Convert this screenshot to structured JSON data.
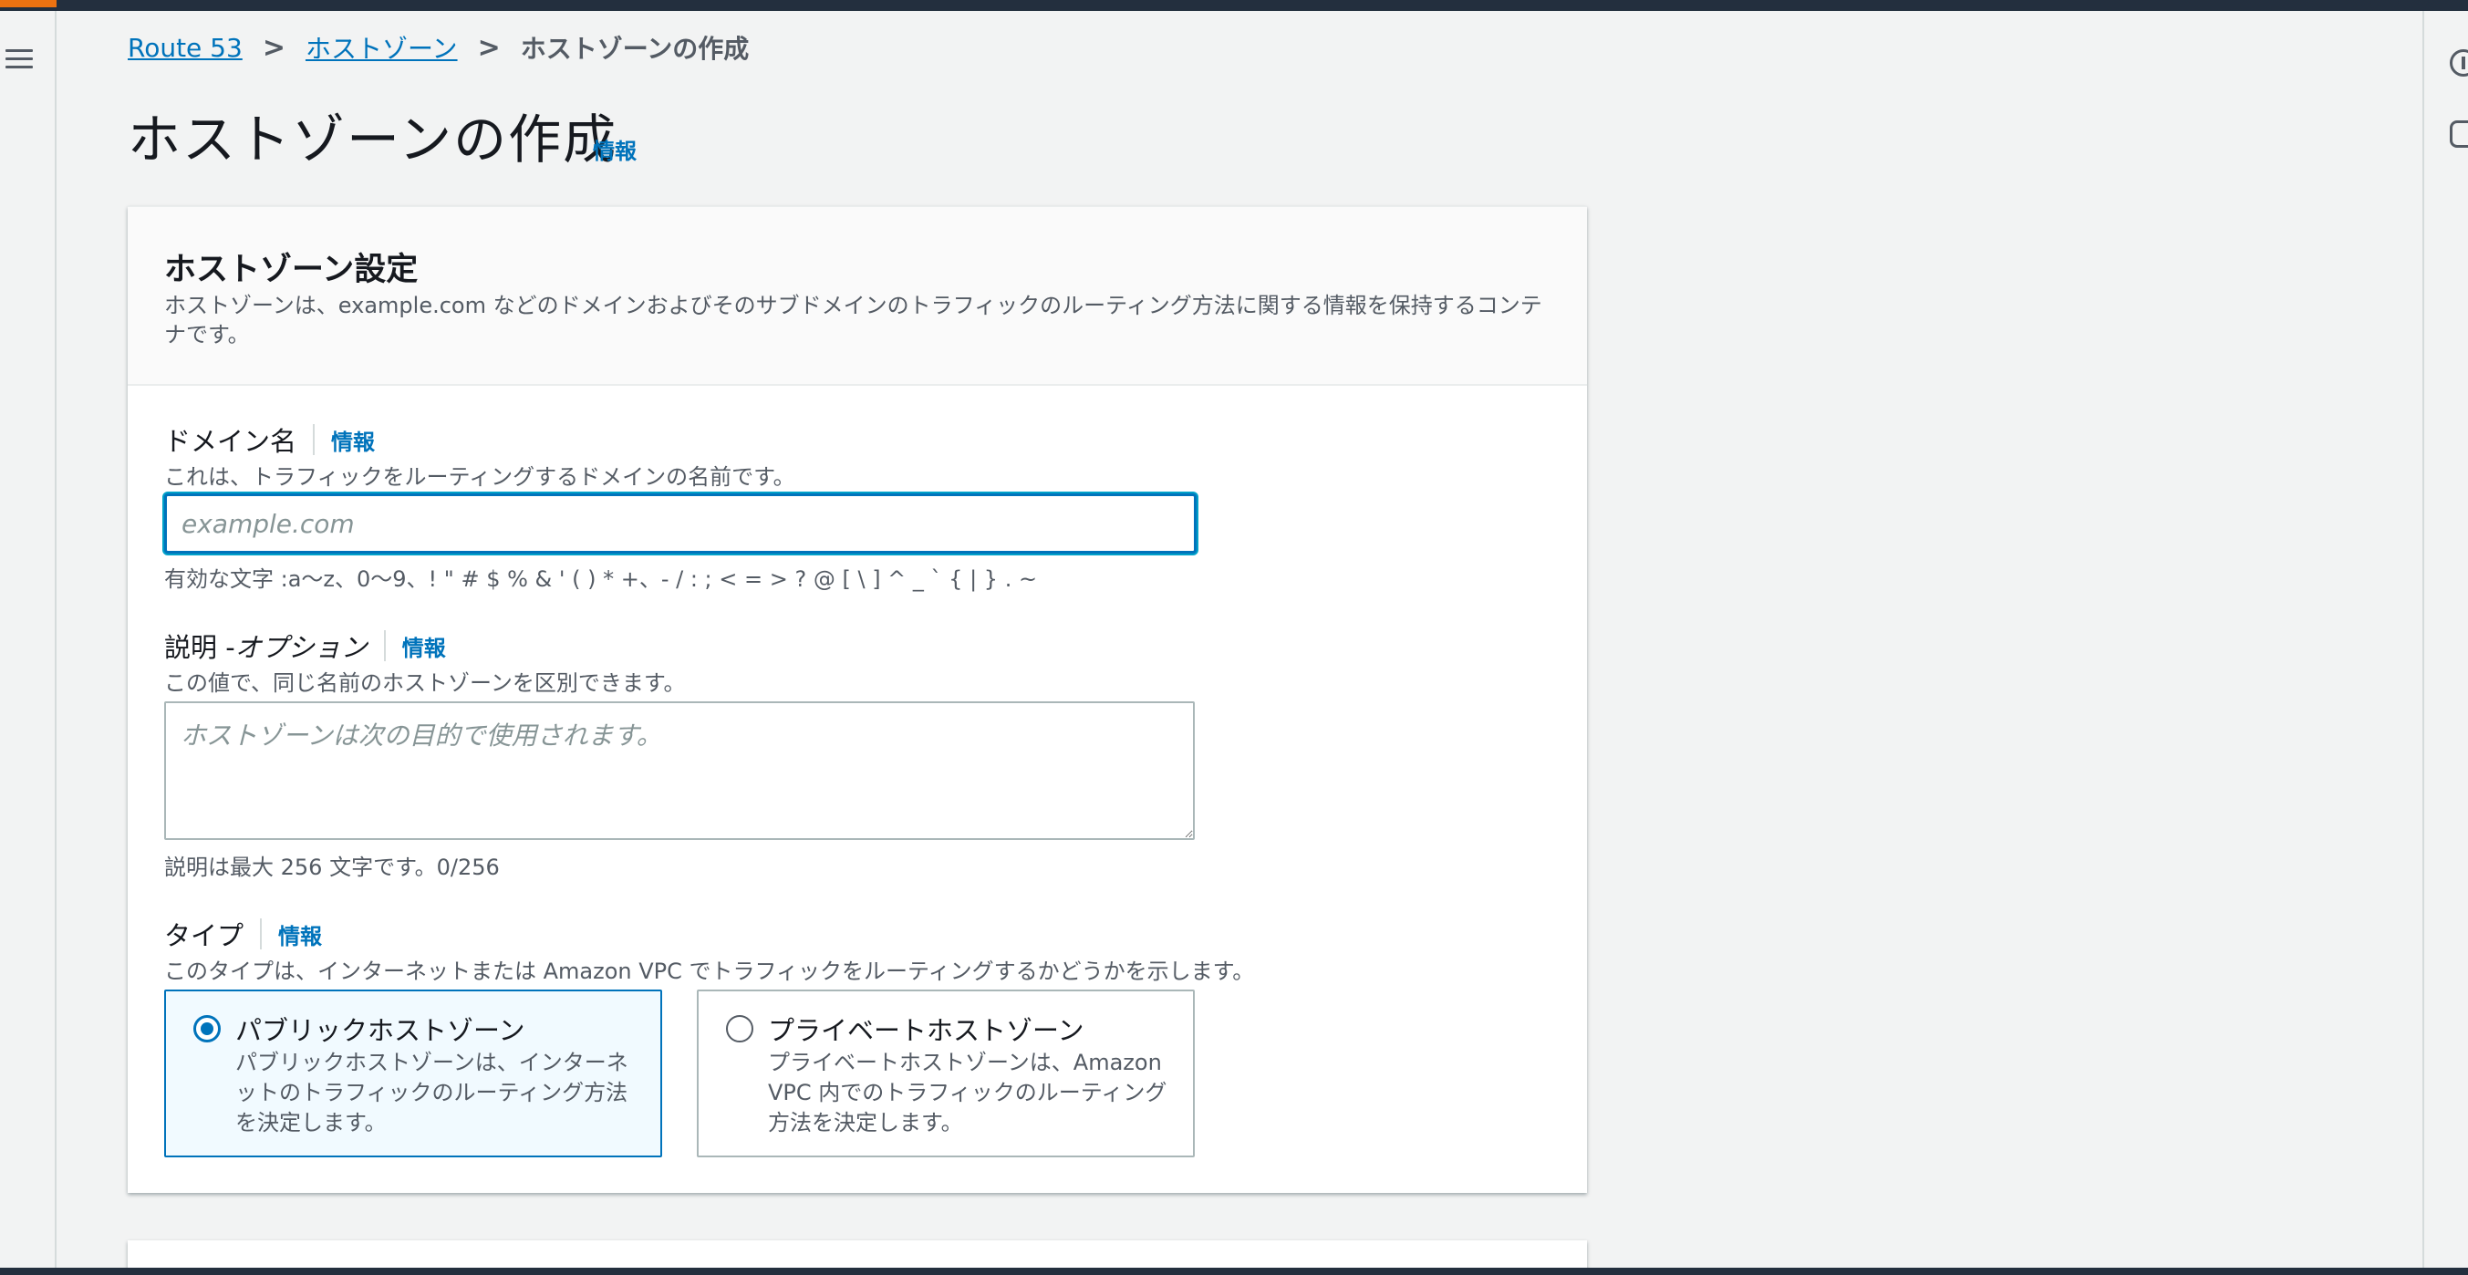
{
  "breadcrumb": {
    "items": [
      "Route 53",
      "ホストゾーン"
    ],
    "current": "ホストゾーンの作成"
  },
  "page": {
    "title": "ホストゾーンの作成",
    "info": "情報"
  },
  "panel": {
    "title": "ホストゾーン設定",
    "description": "ホストゾーンは、example.com などのドメインおよびそのサブドメインのトラフィックのルーティング方法に関する情報を保持するコンテナです。"
  },
  "domain": {
    "label": "ドメイン名",
    "info": "情報",
    "description": "これは、トラフィックをルーティングするドメインの名前です。",
    "placeholder": "example.com",
    "value": "",
    "hint": "有効な文字 :a〜z、0〜9、! \" # $ % & ' ( ) * +、- / : ; < = > ? @ [ \\ ] ^ _ ` { | } . ~"
  },
  "comment": {
    "label": "説明 - ",
    "label_optional": "オプション",
    "info": "情報",
    "description": "この値で、同じ名前のホストゾーンを区別できます。",
    "placeholder": "ホストゾーンは次の目的で使用されます。",
    "value": "",
    "hint": "説明は最大 256 文字です。0/256"
  },
  "type": {
    "label": "タイプ",
    "info": "情報",
    "description": "このタイプは、インターネットまたは Amazon VPC でトラフィックをルーティングするかどうかを示します。",
    "selected": "public",
    "options": [
      {
        "title": "パブリックホストゾーン",
        "description": "パブリックホストゾーンは、インターネットのトラフィックのルーティング方法を決定します。"
      },
      {
        "title": "プライベートホストゾーン",
        "description": "プライベートホストゾーンは、Amazon VPC 内でのトラフィックのルーティング方法を決定します。"
      }
    ]
  },
  "colors": {
    "link": "#0073bb",
    "nav_dark": "#232f3e",
    "accent_orange": "#ec7211"
  }
}
